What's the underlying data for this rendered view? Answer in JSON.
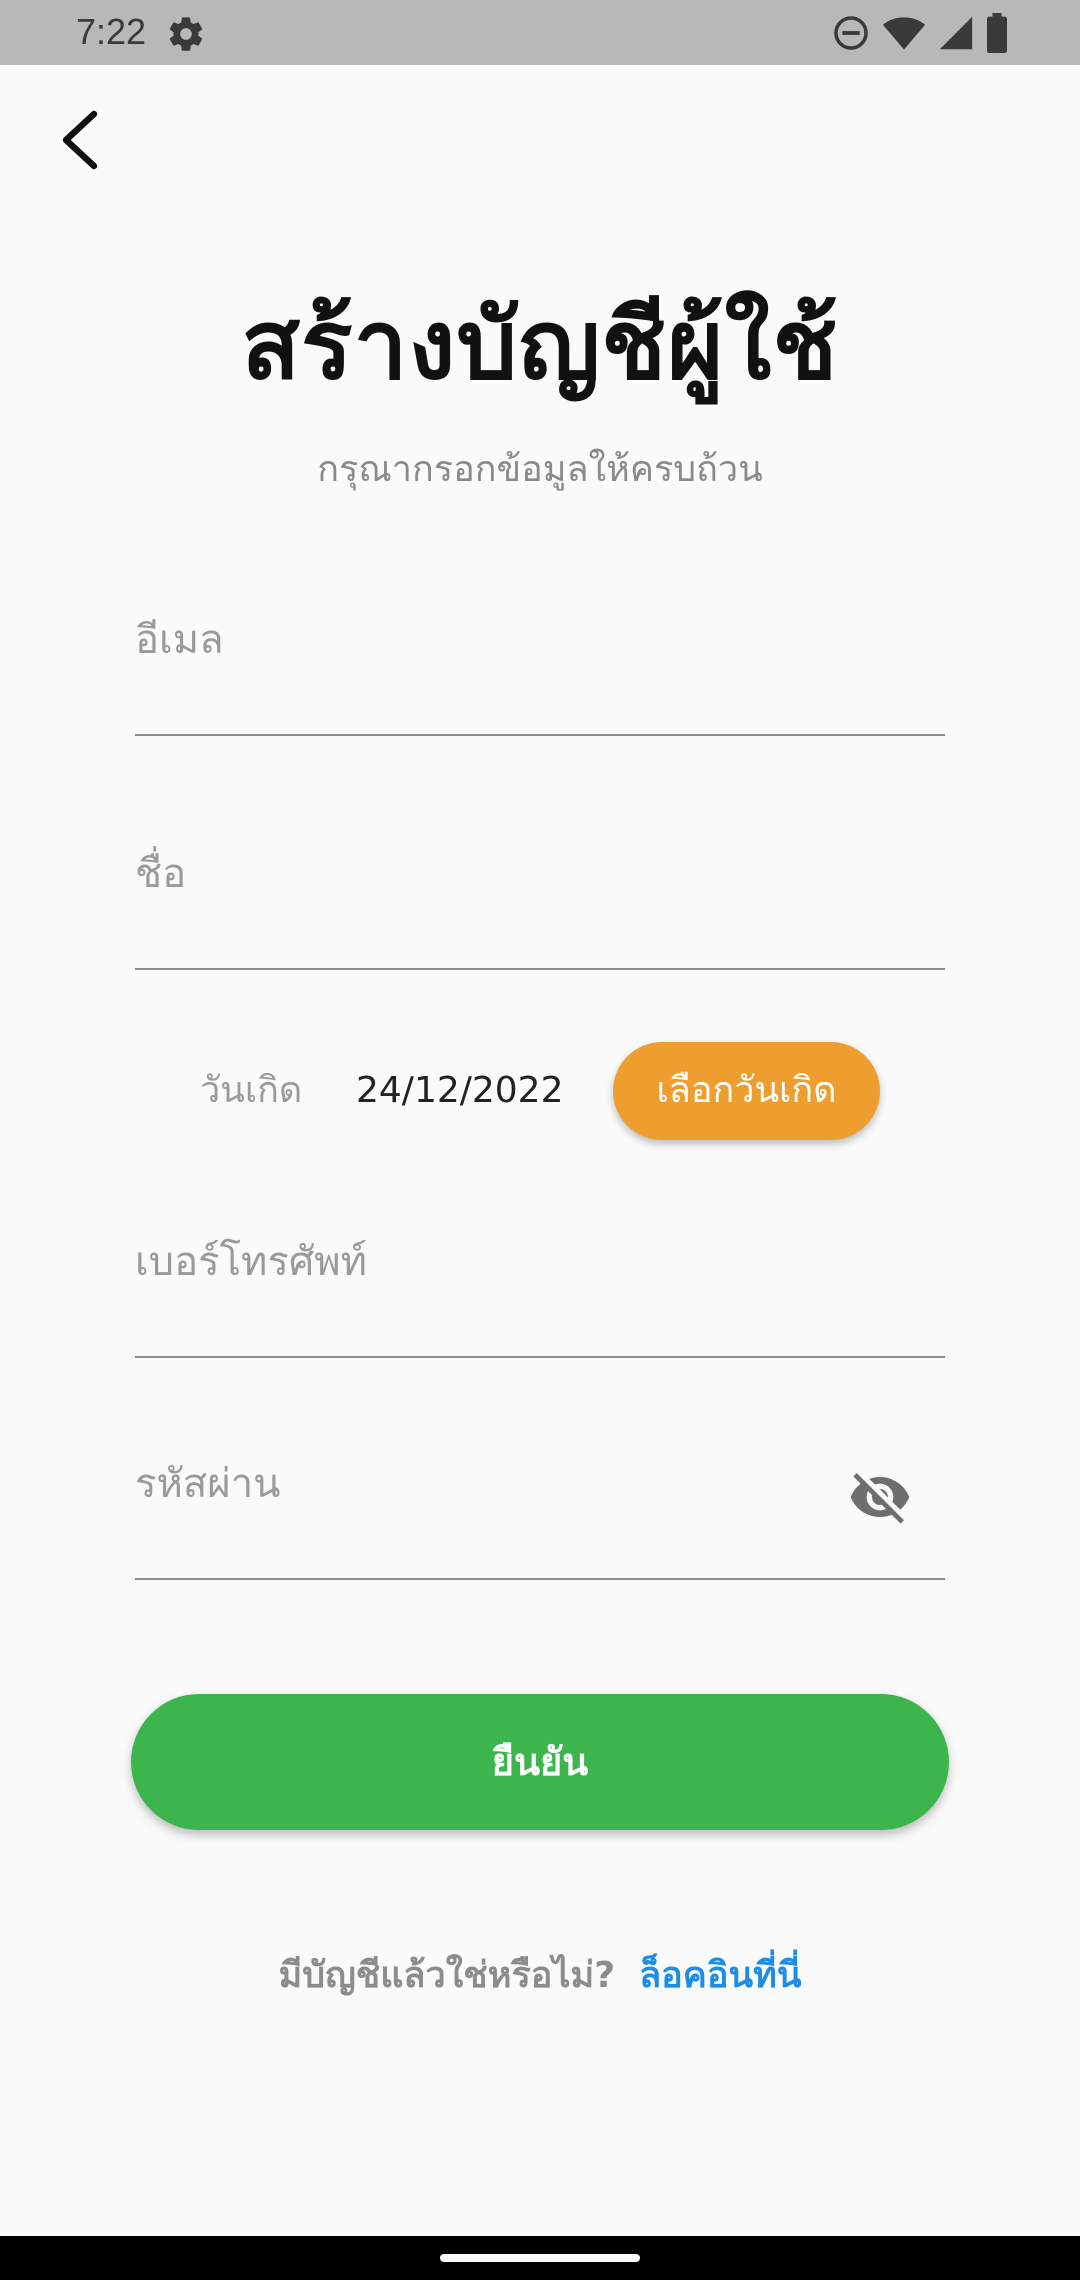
{
  "status_bar": {
    "time": "7:22",
    "icons": [
      "gear-icon",
      "do-not-disturb-icon",
      "wifi-icon",
      "signal-icon",
      "battery-icon"
    ],
    "background": "#b8b8b8"
  },
  "header": {
    "back_icon": "chevron-left-icon"
  },
  "title": "สร้างบัญชีผู้ใช้",
  "subtitle": "กรุณากรอกข้อมูลให้ครบถ้วน",
  "form": {
    "email": {
      "placeholder": "อีเมล",
      "value": ""
    },
    "name": {
      "placeholder": "ชื่อ",
      "value": ""
    },
    "birthday": {
      "label": "วันเกิด",
      "value": "24/12/2022",
      "button_label": "เลือกวันเกิด",
      "button_color": "#ed9e2f"
    },
    "phone": {
      "placeholder": "เบอร์โทรศัพท์",
      "value": ""
    },
    "password": {
      "placeholder": "รหัสผ่าน",
      "value": "",
      "toggle_icon": "eye-off-icon"
    }
  },
  "confirm_button": {
    "label": "ยืนยัน",
    "color": "#3cb64c"
  },
  "login_prompt": {
    "text": "มีบัญชีแล้วใช่หรือไม่?",
    "link": "ล็อคอินที่นี่",
    "link_color": "#1f8de3"
  }
}
